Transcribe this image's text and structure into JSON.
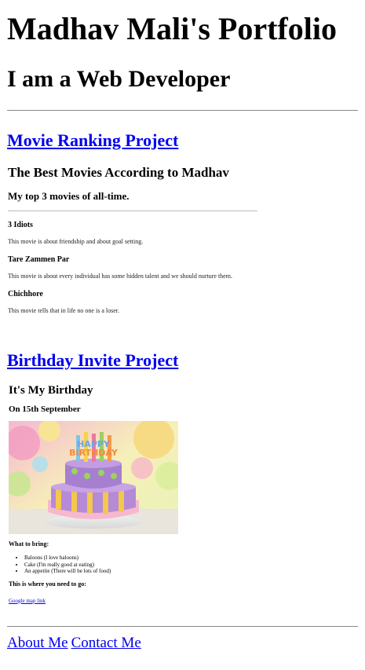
{
  "header": {
    "title": "Madhav Mali's Portfolio",
    "subtitle": "I am a Web Developer"
  },
  "projects": {
    "movie": {
      "link_label": "Movie Ranking Project",
      "heading": "The Best Movies According to Madhav",
      "subheading": "My top 3 movies of all-time.",
      "movies": [
        {
          "title": "3 Idiots",
          "description": "This movie is about friendship and about goal setting."
        },
        {
          "title": "Tare Zammen Par",
          "description": "This movie is about every individual has some hidden talent and we should nurture them."
        },
        {
          "title": "Chichhore",
          "description": "This movie tells that in life no one is a loser."
        }
      ]
    },
    "birthday": {
      "link_label": "Birthday Invite Project",
      "heading": "It's My Birthday",
      "date": "On 15th September",
      "cake_text": "HAPPY BIRTHDAY",
      "bring_heading": "What to bring:",
      "bring_items": [
        "Baloons (I love baloons)",
        "Cake (I'm really good at eating)",
        "An appetite (There will be lots of food)"
      ],
      "where_heading": "This is where you need to go:",
      "map_link": "Google map link"
    }
  },
  "footer": {
    "about": "About Me",
    "contact": "Contact Me"
  }
}
